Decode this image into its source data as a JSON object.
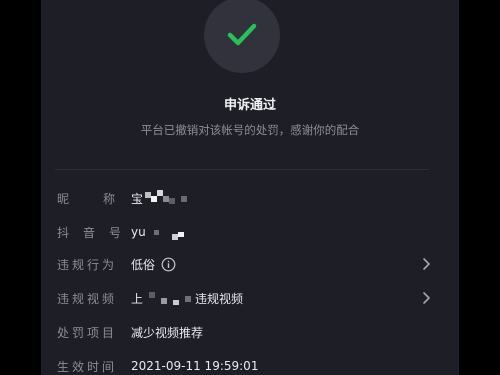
{
  "result": {
    "title": "申诉通过",
    "subtitle": "平台已撤销对该帐号的处罚，感谢你的配合"
  },
  "details": {
    "nickname": {
      "label": "昵称",
      "value": "宝"
    },
    "douyin_id": {
      "label": "抖音号",
      "value": "yu"
    },
    "violation_type": {
      "label": "违规行为",
      "value": "低俗"
    },
    "violation_video": {
      "label": "违规视频",
      "value_prefix": "上",
      "value_suffix": "违规视频"
    },
    "penalty": {
      "label": "处罚项目",
      "value": "减少视频推荐"
    },
    "effective_time": {
      "label": "生效时间",
      "value": "2021-09-11 19:59:01"
    }
  },
  "colors": {
    "accent": "#25c25a",
    "panel": "#1d1e26",
    "label": "#8c8d95"
  },
  "icons": [
    "check-icon",
    "info-icon",
    "chevron-right-icon"
  ]
}
